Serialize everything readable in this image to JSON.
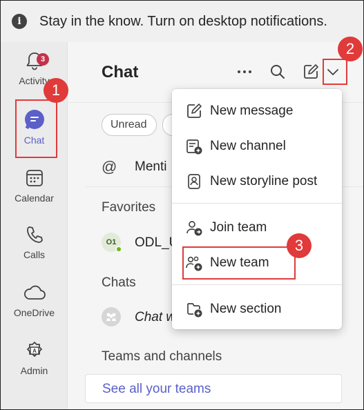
{
  "banner": {
    "text": "Stay in the know. Turn on desktop notifications.",
    "icon": "info-icon"
  },
  "rail": {
    "items": [
      {
        "label": "Activity",
        "icon": "bell-icon",
        "badge": "3"
      },
      {
        "label": "Chat",
        "icon": "chat-icon"
      },
      {
        "label": "Calendar",
        "icon": "calendar-icon"
      },
      {
        "label": "Calls",
        "icon": "phone-icon"
      },
      {
        "label": "OneDrive",
        "icon": "cloud-icon"
      },
      {
        "label": "Admin",
        "icon": "admin-icon"
      }
    ]
  },
  "header": {
    "title": "Chat"
  },
  "filters": {
    "unread": "Unread"
  },
  "list": {
    "mentions": "Menti",
    "favorites_heading": "Favorites",
    "favorite_avatar": "O1",
    "favorite_name": "ODL_U",
    "chats_heading": "Chats",
    "chat_name": "Chat w",
    "teams_heading": "Teams and channels",
    "see_all": "See all your teams"
  },
  "menu": {
    "items": [
      {
        "label": "New message",
        "icon": "compose-icon"
      },
      {
        "label": "New channel",
        "icon": "new-channel-icon"
      },
      {
        "label": "New storyline post",
        "icon": "storyline-icon"
      },
      {
        "label": "Join team",
        "icon": "join-team-icon"
      },
      {
        "label": "New team",
        "icon": "new-team-icon"
      },
      {
        "label": "New section",
        "icon": "new-section-icon"
      }
    ]
  },
  "annotations": {
    "m1": "1",
    "m2": "2",
    "m3": "3"
  },
  "colors": {
    "accent": "#5b5fc7",
    "annotation": "#e03a3a",
    "badge": "#c4314b"
  }
}
